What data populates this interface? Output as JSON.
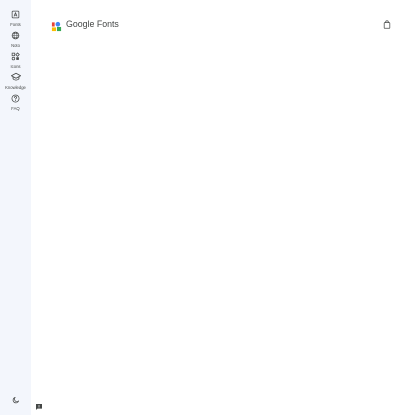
{
  "nav": {
    "items": [
      {
        "label": "Fonts",
        "icon": "font-icon"
      },
      {
        "label": "Noto",
        "icon": "globe-icon"
      },
      {
        "label": "Icons",
        "icon": "icons-icon"
      },
      {
        "label": "Knowledge",
        "icon": "graduation-cap-icon"
      },
      {
        "label": "FAQ",
        "icon": "help-circle-icon"
      }
    ]
  },
  "header": {
    "brand_google": "Google",
    "brand_product": "Fonts",
    "bag_icon": "shopping-bag-icon"
  },
  "footer": {
    "theme_icon": "moon-icon",
    "feedback_icon": "feedback-icon"
  },
  "colors": {
    "rail_background": "#f3f6fc",
    "icon_color": "#444746",
    "logo_blue": "#4285f4",
    "logo_red": "#ea4335",
    "logo_yellow": "#fbbc04",
    "logo_green": "#34a853"
  }
}
